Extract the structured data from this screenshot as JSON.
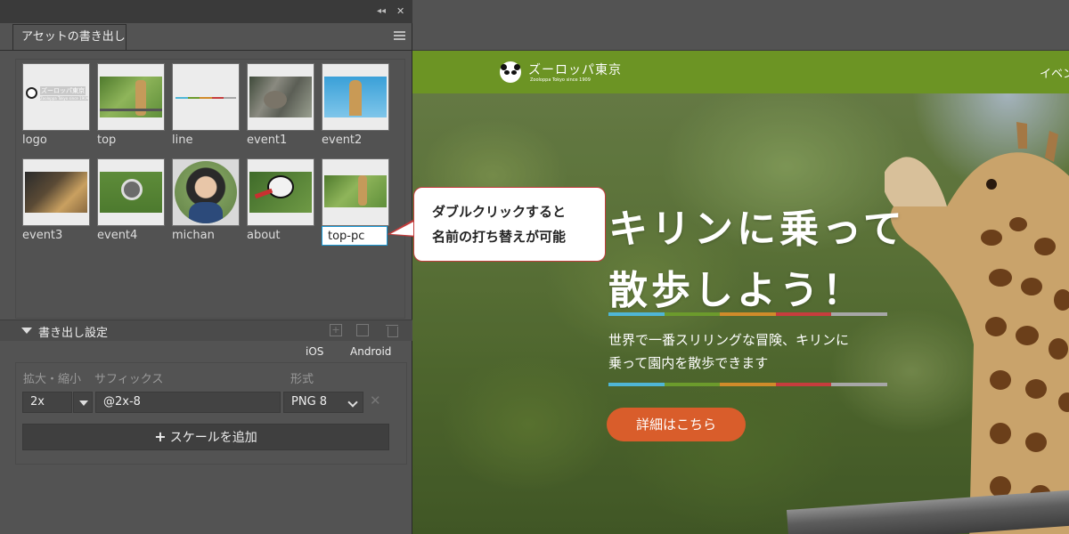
{
  "panel": {
    "tab": "アセットの書き出し",
    "assets": [
      {
        "name": "logo"
      },
      {
        "name": "top"
      },
      {
        "name": "line"
      },
      {
        "name": "event1"
      },
      {
        "name": "event2"
      },
      {
        "name": "event3"
      },
      {
        "name": "event4"
      },
      {
        "name": "michan"
      },
      {
        "name": "about"
      }
    ],
    "rename_value": "top-pc",
    "thumb_logo": {
      "title": "ズーロッパ東京",
      "sub": "Zooloppa Tokyo since 1909"
    }
  },
  "callout": {
    "line1": "ダブルクリックすると",
    "line2": "名前の打ち替えが可能"
  },
  "export": {
    "title": "書き出し設定",
    "ios": "iOS",
    "android": "Android",
    "col_scale": "拡大・縮小",
    "col_suffix": "サフィックス",
    "col_format": "形式",
    "scale": "2x",
    "suffix": "@2x-8",
    "format": "PNG 8",
    "add_scale": "スケールを追加"
  },
  "site": {
    "logo_title": "ズーロッパ東京",
    "logo_sub": "Zooloppa Tokyo since 1909",
    "nav_item": "イベン",
    "hero_title_1": "キリンに乗って",
    "hero_title_2": "散歩しよう！",
    "hero_desc_1": "世界で一番スリリングな冒険、キリンに",
    "hero_desc_2": "乗って園内を散歩できます",
    "cta": "詳細はこちら",
    "bar_colors": [
      "#4fb6d6",
      "#6c9b2c",
      "#d08b2a",
      "#c63d3d",
      "#a7a7a7"
    ]
  }
}
